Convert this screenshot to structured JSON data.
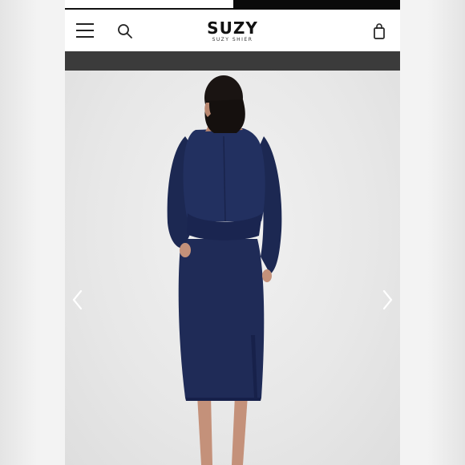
{
  "header": {
    "logo_main": "SUZY",
    "logo_sub": "SUZY SHIER",
    "icons": {
      "menu": "hamburger-menu-icon",
      "search": "search-icon",
      "cart": "shopping-bag-icon"
    }
  },
  "gallery": {
    "icons": {
      "previous": "chevron-left-icon",
      "next": "chevron-right-icon"
    }
  },
  "colors": {
    "header_bg": "#ffffff",
    "promo_bar": "#3b3b3b",
    "garment": "#1d2a55",
    "background": "#e9e9e9"
  }
}
